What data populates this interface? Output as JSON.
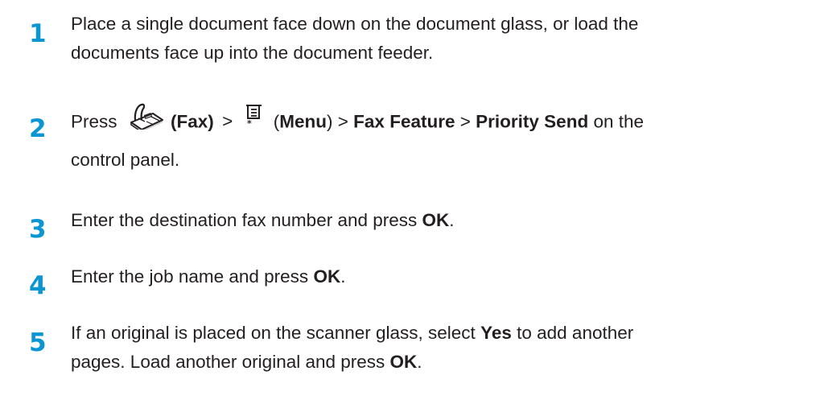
{
  "steps": [
    {
      "number": "1",
      "line1": "Place a single document face down on the document glass, or load the",
      "line2": "documents face up into the document feeder."
    },
    {
      "number": "2",
      "press": "Press",
      "fax_label": "(Fax)",
      "sep1": ">",
      "menu_open": "(",
      "menu_label": "Menu",
      "menu_close": ")",
      "sep2": ">",
      "fax_feature": "Fax Feature",
      "sep3": ">",
      "priority_send": "Priority Send",
      "tail": "on the",
      "line2": "control panel.",
      "fax_icon": "fax-machine-icon",
      "menu_icon": "menu-icon"
    },
    {
      "number": "3",
      "text": "Enter the destination fax number and press",
      "ok": "OK",
      "end": "."
    },
    {
      "number": "4",
      "text": "Enter the job name and press",
      "ok": "OK",
      "end": "."
    },
    {
      "number": "5",
      "line1_a": "If an original is placed on the scanner glass, select",
      "yes": "Yes",
      "line1_b": "to add another",
      "line2_a": "pages. Load another original and press",
      "ok": "OK",
      "end": "."
    }
  ],
  "colors": {
    "step_number": "#0a95d3",
    "text": "#231f20"
  }
}
